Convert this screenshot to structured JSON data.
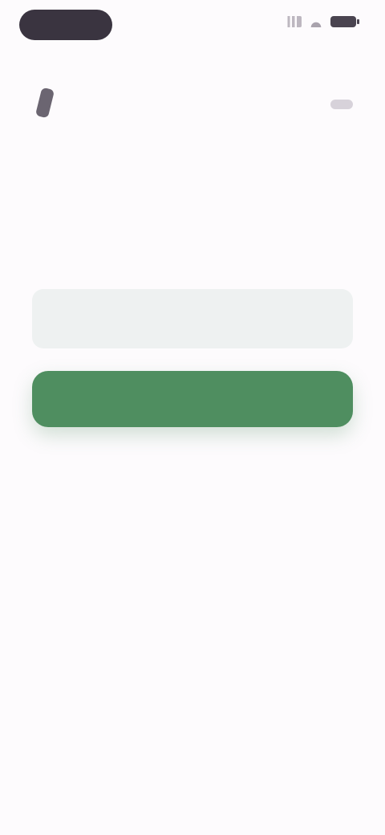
{
  "status_bar": {
    "time": "",
    "icons": [
      "signal-icon",
      "wifi-icon",
      "battery-icon"
    ]
  },
  "header": {
    "brand_text": "",
    "menu_icon": "menu-icon"
  },
  "content": {
    "title": "",
    "subtitle": "",
    "input_placeholder": "",
    "button_label": ""
  },
  "footer": {
    "text": "",
    "link_text": ""
  },
  "colors": {
    "background": "#fdfbfd",
    "primary": "#4f8e60",
    "input_bg": "#eef1f1",
    "text_primary": "#3e3844",
    "text_secondary": "#8a8590"
  }
}
